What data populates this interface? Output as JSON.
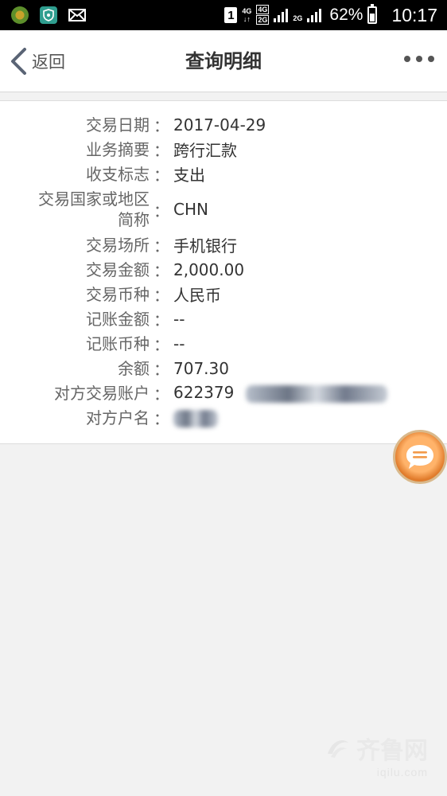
{
  "status_bar": {
    "sim_slot": "1",
    "network_1": "4G",
    "network_2_top": "4G",
    "network_2_bottom": "2G",
    "network_3": "2G",
    "battery_percent": "62%",
    "battery_level": 0.62,
    "time": "10:17"
  },
  "nav": {
    "back_label": "返回",
    "title": "查询明细"
  },
  "details": [
    {
      "label": "交易日期",
      "value": "2017-04-29"
    },
    {
      "label": "业务摘要",
      "value": "跨行汇款"
    },
    {
      "label": "收支标志",
      "value": "支出"
    },
    {
      "label_line1": "交易国家或地区",
      "label_line2": "简称",
      "value": "CHN"
    },
    {
      "label": "交易场所",
      "value": "手机银行"
    },
    {
      "label": "交易金额",
      "value": "2,000.00"
    },
    {
      "label": "交易币种",
      "value": "人民币"
    },
    {
      "label": "记账金额",
      "value": "--"
    },
    {
      "label": "记账币种",
      "value": "--"
    },
    {
      "label": "余额",
      "value": "707.30"
    },
    {
      "label": "对方交易账户",
      "value": "622379"
    },
    {
      "label": "对方户名",
      "value": ""
    }
  ],
  "colon": "：",
  "watermark": {
    "brand": "齐鲁网",
    "url": "iqilu.com"
  },
  "colors": {
    "nav_background": "#ffffff",
    "page_background": "#f2f2f2",
    "fab_orange": "#f29a4a"
  }
}
